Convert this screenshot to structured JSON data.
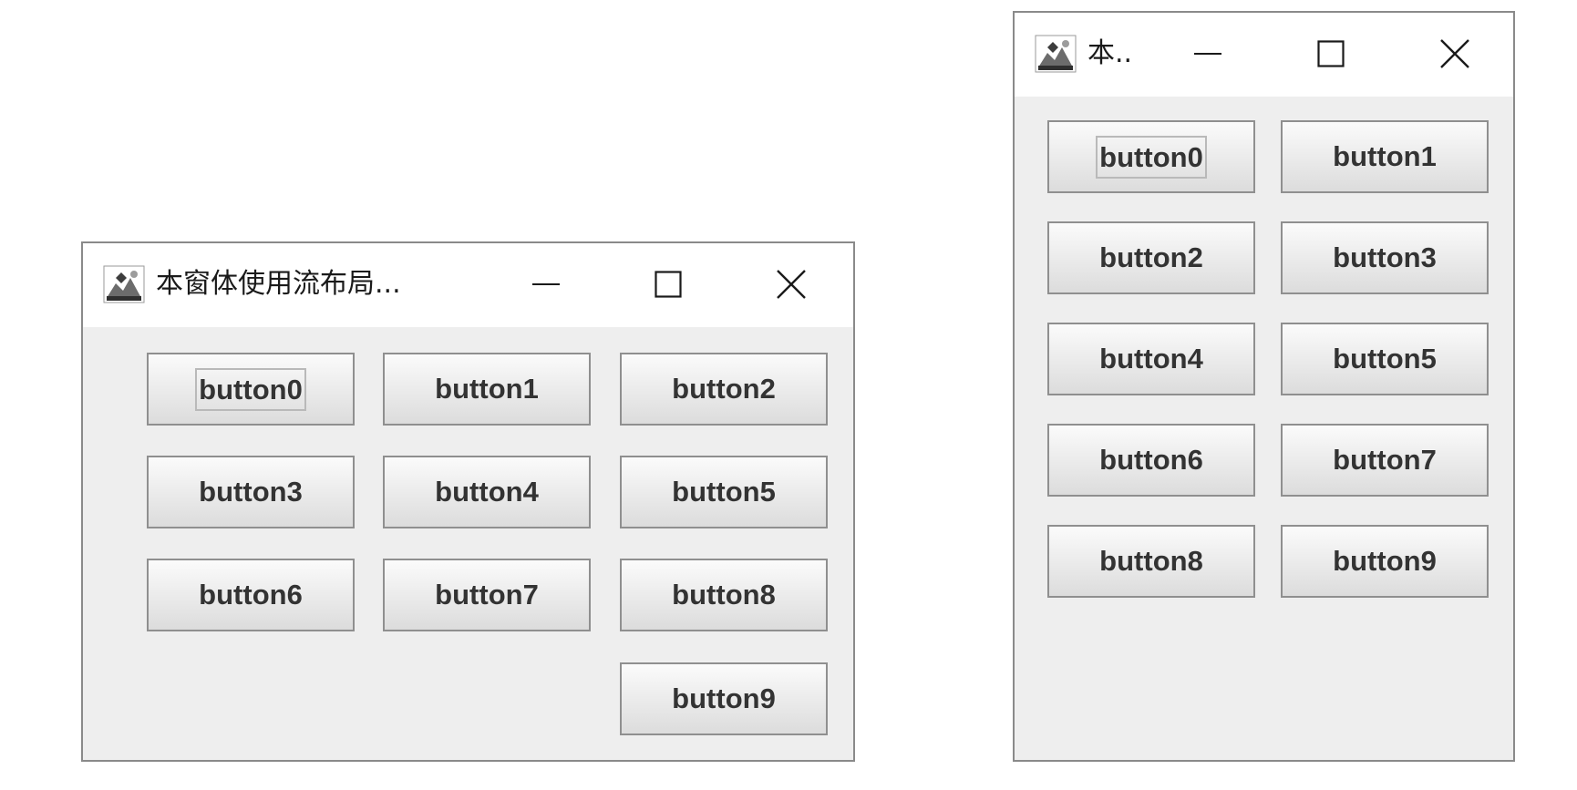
{
  "windows": [
    {
      "title": "本窗体使用流布局...",
      "controls": {
        "minimize": "—",
        "maximize": "☐",
        "close": "✕"
      },
      "buttons": [
        "button0",
        "button1",
        "button2",
        "button3",
        "button4",
        "button5",
        "button6",
        "button7",
        "button8",
        "button9"
      ],
      "focused": "button0"
    },
    {
      "title": "本..",
      "controls": {
        "minimize": "—",
        "maximize": "☐",
        "close": "✕"
      },
      "buttons": [
        "button0",
        "button1",
        "button2",
        "button3",
        "button4",
        "button5",
        "button6",
        "button7",
        "button8",
        "button9"
      ],
      "focused": "button0"
    }
  ],
  "colors": {
    "window_bg": "#eeeeee",
    "titlebar_bg": "#ffffff",
    "button_border": "#8f8f8f",
    "button_text": "#333333"
  },
  "icons": [
    "java-app-icon",
    "minimize-icon",
    "maximize-icon",
    "close-icon"
  ]
}
